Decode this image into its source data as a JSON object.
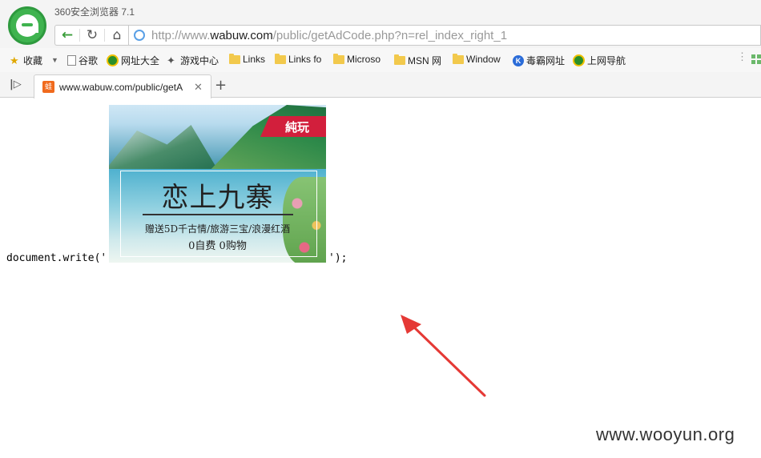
{
  "window": {
    "title": "360安全浏览器 7.1"
  },
  "nav": {
    "address_prefix": "http://www.",
    "address_host": "wabuw.com",
    "address_path": "/public/getAdCode.php?n=rel_index_right_1"
  },
  "bookmarks": [
    {
      "label": "收藏",
      "icon": "star-icon"
    },
    {
      "label": "谷歌",
      "icon": "page-icon"
    },
    {
      "label": "网址大全",
      "icon": "green-plus-icon"
    },
    {
      "label": "游戏中心",
      "icon": "gamepad-icon"
    },
    {
      "label": "Links",
      "icon": "folder-icon"
    },
    {
      "label": "Links fo",
      "icon": "folder-icon"
    },
    {
      "label": "Microso",
      "icon": "folder-icon"
    },
    {
      "label": "MSN 网",
      "icon": "folder-icon"
    },
    {
      "label": "Window",
      "icon": "folder-icon"
    },
    {
      "label": "毒霸网址",
      "icon": "k-icon"
    },
    {
      "label": "上网导航",
      "icon": "green-plus-icon"
    }
  ],
  "tabs": [
    {
      "title": "www.wabuw.com/public/getA",
      "favicon_text": "蛙"
    }
  ],
  "content": {
    "code_prefix": "document.write('",
    "code_suffix": "');",
    "ad": {
      "badge": "純玩",
      "title": "恋上九寨",
      "subtitle": "赠送5D千古情/旅游三宝/浪漫红酒",
      "subtitle2": "0自费 0购物"
    }
  },
  "watermark": "www.wooyun.org",
  "colors": {
    "accent_green": "#3fb34f",
    "arrow_red": "#e53935",
    "badge_red": "#d21f3c"
  }
}
